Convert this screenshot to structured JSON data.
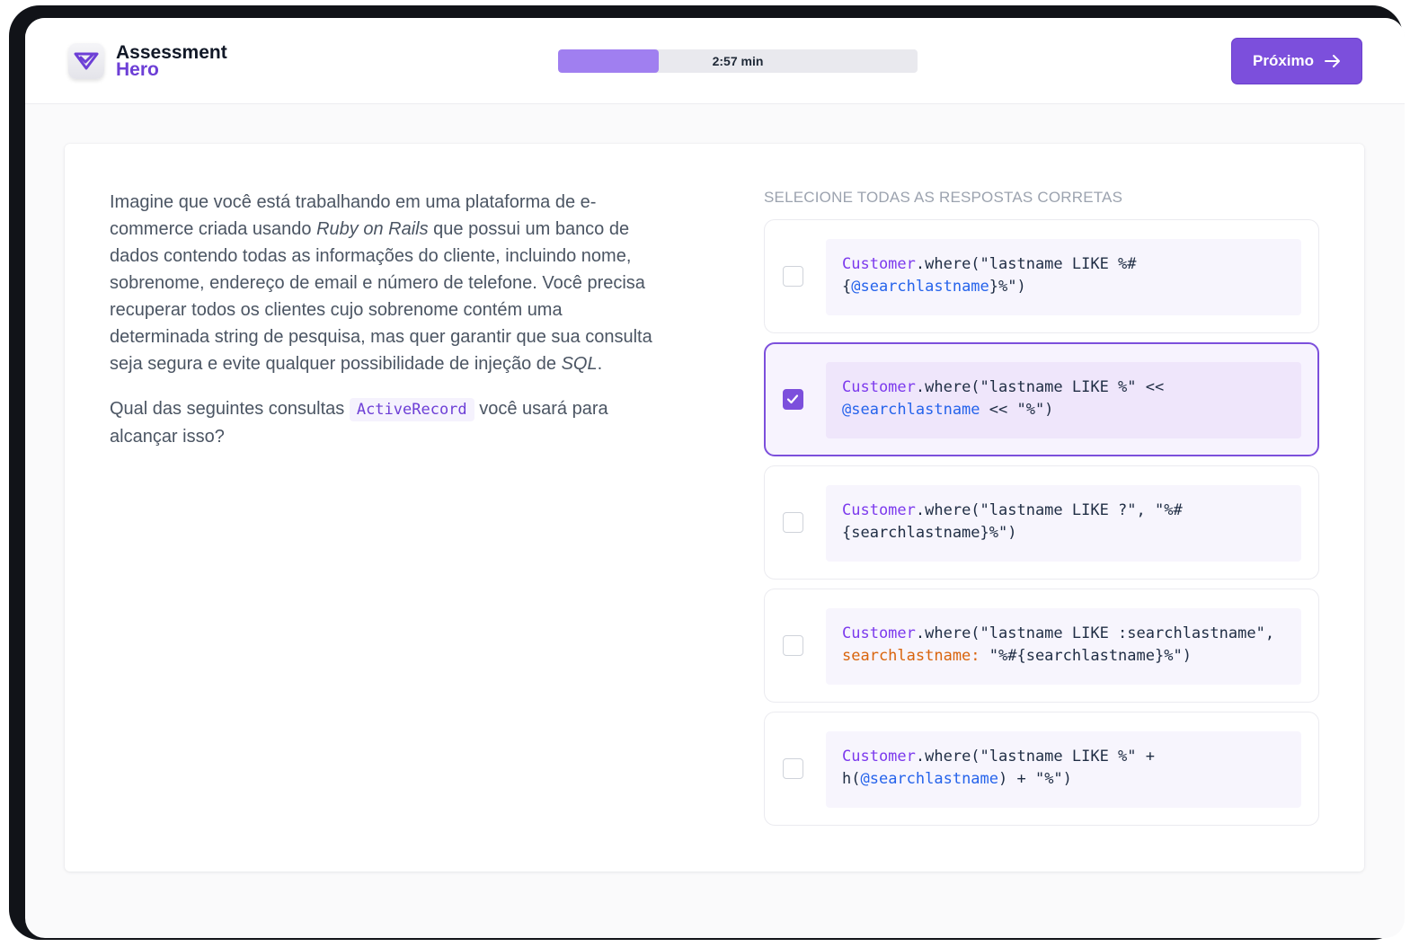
{
  "brand": {
    "line1": "Assessment",
    "line2": "Hero",
    "accent": "#7c4fdc"
  },
  "timer": {
    "label": "2:57 min",
    "progress_fraction": 0.28
  },
  "next_button": {
    "label": "Próximo"
  },
  "question": {
    "p1_a": "Imagine que você está trabalhando em uma plataforma de e-commerce criada usando ",
    "p1_em1": "Ruby on Rails",
    "p1_b": " que possui um banco de dados contendo todas as informações do cliente, incluindo nome, sobrenome, endereço de email e número de telefone. Você precisa recuperar todos os clientes cujo sobrenome contém uma determinada string de pesquisa, mas quer garantir que sua consulta seja segura e evite qualquer possibilidade de injeção de ",
    "p1_em2": "SQL",
    "p1_c": ".",
    "p2_a": "Qual das seguintes consultas ",
    "p2_code": "ActiveRecord",
    "p2_b": " você usará para alcançar isso?"
  },
  "answers": {
    "instruction": "SELECIONE TODAS AS RESPOSTAS CORRETAS",
    "options": [
      {
        "selected": false,
        "cls": "Customer",
        "a": ".where(\"lastname LIKE %#",
        "b": "{",
        "ivar": "@searchlastname",
        "c": "}%\")"
      },
      {
        "selected": true,
        "cls": "Customer",
        "a": ".where(\"lastname LIKE %\" <<",
        "ivar": "@searchlastname",
        "b": " << \"%\")"
      },
      {
        "selected": false,
        "cls": "Customer",
        "a": ".where(\"lastname LIKE ?\", \"%#",
        "b": "{searchlastname}%\")"
      },
      {
        "selected": false,
        "cls": "Customer",
        "a": ".where(\"lastname LIKE :searchlastname\",",
        "sym": "searchlastname:",
        "b": " \"%#{searchlastname}%\")"
      },
      {
        "selected": false,
        "cls": "Customer",
        "a": ".where(\"lastname LIKE %\" +",
        "b": "h(",
        "ivar": "@searchlastname",
        "c": ") + \"%\")"
      }
    ]
  }
}
